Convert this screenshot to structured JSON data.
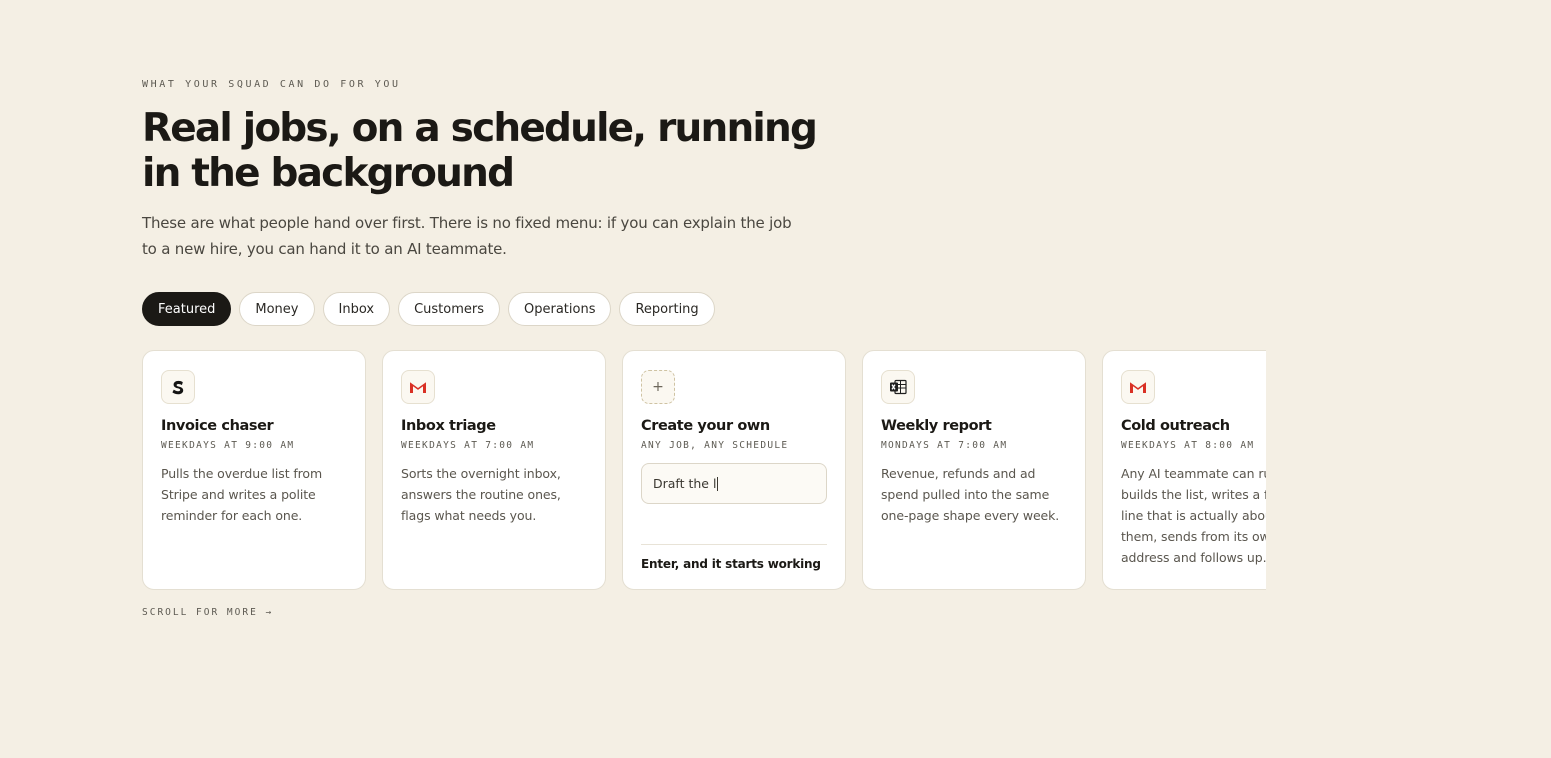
{
  "header": {
    "eyebrow": "WHAT YOUR SQUAD CAN DO FOR YOU",
    "title": "Real jobs, on a schedule, running in the background",
    "subtitle": "These are what people hand over first. There is no fixed menu: if you can explain the job to a new hire, you can hand it to an AI teammate."
  },
  "filters": [
    {
      "label": "Featured",
      "active": true
    },
    {
      "label": "Money",
      "active": false
    },
    {
      "label": "Inbox",
      "active": false
    },
    {
      "label": "Customers",
      "active": false
    },
    {
      "label": "Operations",
      "active": false
    },
    {
      "label": "Reporting",
      "active": false
    }
  ],
  "cards": [
    {
      "icon": "stripe-icon",
      "title": "Invoice chaser",
      "schedule": "WEEKDAYS AT 9:00 AM",
      "description": "Pulls the overdue list from Stripe and writes a polite reminder for each one."
    },
    {
      "icon": "gmail-icon",
      "title": "Inbox triage",
      "schedule": "WEEKDAYS AT 7:00 AM",
      "description": "Sorts the overnight inbox, answers the routine ones, flags what needs you."
    },
    {
      "icon": "plus-icon",
      "title": "Create your own",
      "schedule": "ANY JOB, ANY SCHEDULE",
      "input_value": "Draft the l",
      "footer": "Enter, and it starts working"
    },
    {
      "icon": "excel-icon",
      "title": "Weekly report",
      "schedule": "MONDAYS AT 7:00 AM",
      "description": "Revenue, refunds and ad spend pulled into the same one-page shape every week."
    },
    {
      "icon": "gmail-icon",
      "title": "Cold outreach",
      "schedule": "WEEKDAYS AT 8:00 AM",
      "description": "Any AI teammate can run it: builds the list, writes a first line that is actually about them, sends from its own address and follows up."
    }
  ],
  "scroll_hint": "SCROLL FOR MORE →",
  "colors": {
    "background": "#f4efe4",
    "accent_dark": "#1b1915",
    "gmail_red": "#d93025",
    "excel_dark": "#1f1f1f"
  }
}
